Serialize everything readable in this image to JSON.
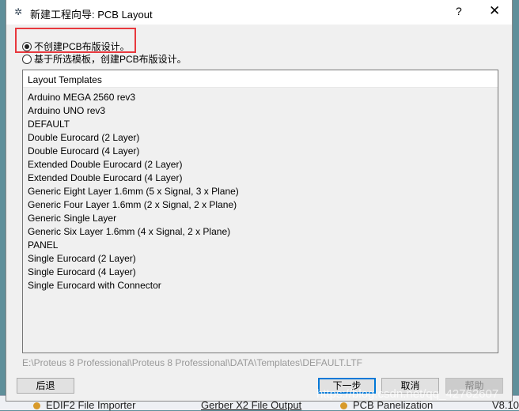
{
  "window": {
    "title": "新建工程向导: PCB Layout",
    "help": "?",
    "close": "✕"
  },
  "options": [
    {
      "label": "不创建PCB布版设计。",
      "selected": true
    },
    {
      "label": "基于所选模板，创建PCB布版设计。",
      "selected": false
    }
  ],
  "list": {
    "header": "Layout Templates",
    "items": [
      "Arduino MEGA 2560 rev3",
      "Arduino UNO rev3",
      "DEFAULT",
      "Double Eurocard (2 Layer)",
      "Double Eurocard (4 Layer)",
      "Extended Double Eurocard (2 Layer)",
      "Extended Double Eurocard (4 Layer)",
      "Generic Eight Layer 1.6mm (5 x Signal, 3 x Plane)",
      "Generic Four Layer 1.6mm (2 x Signal, 2 x Plane)",
      "Generic Single Layer",
      "Generic Six Layer 1.6mm (4 x Signal, 2 x Plane)",
      "PANEL",
      "Single Eurocard (2 Layer)",
      "Single Eurocard (4 Layer)",
      "Single Eurocard with Connector"
    ]
  },
  "path": "E:\\Proteus 8 Professional\\Proteus 8 Professional\\DATA\\Templates\\DEFAULT.LTF",
  "buttons": {
    "back": "后退",
    "next": "下一步",
    "cancel": "取消",
    "help": "帮助"
  },
  "background": {
    "item1": "EDIF2 File Importer",
    "item2": "Gerber X2 File Output",
    "item3": "PCB Panelization",
    "item4": "V8.10"
  },
  "watermark": "https://blog.csdn.net/qq_42762607"
}
